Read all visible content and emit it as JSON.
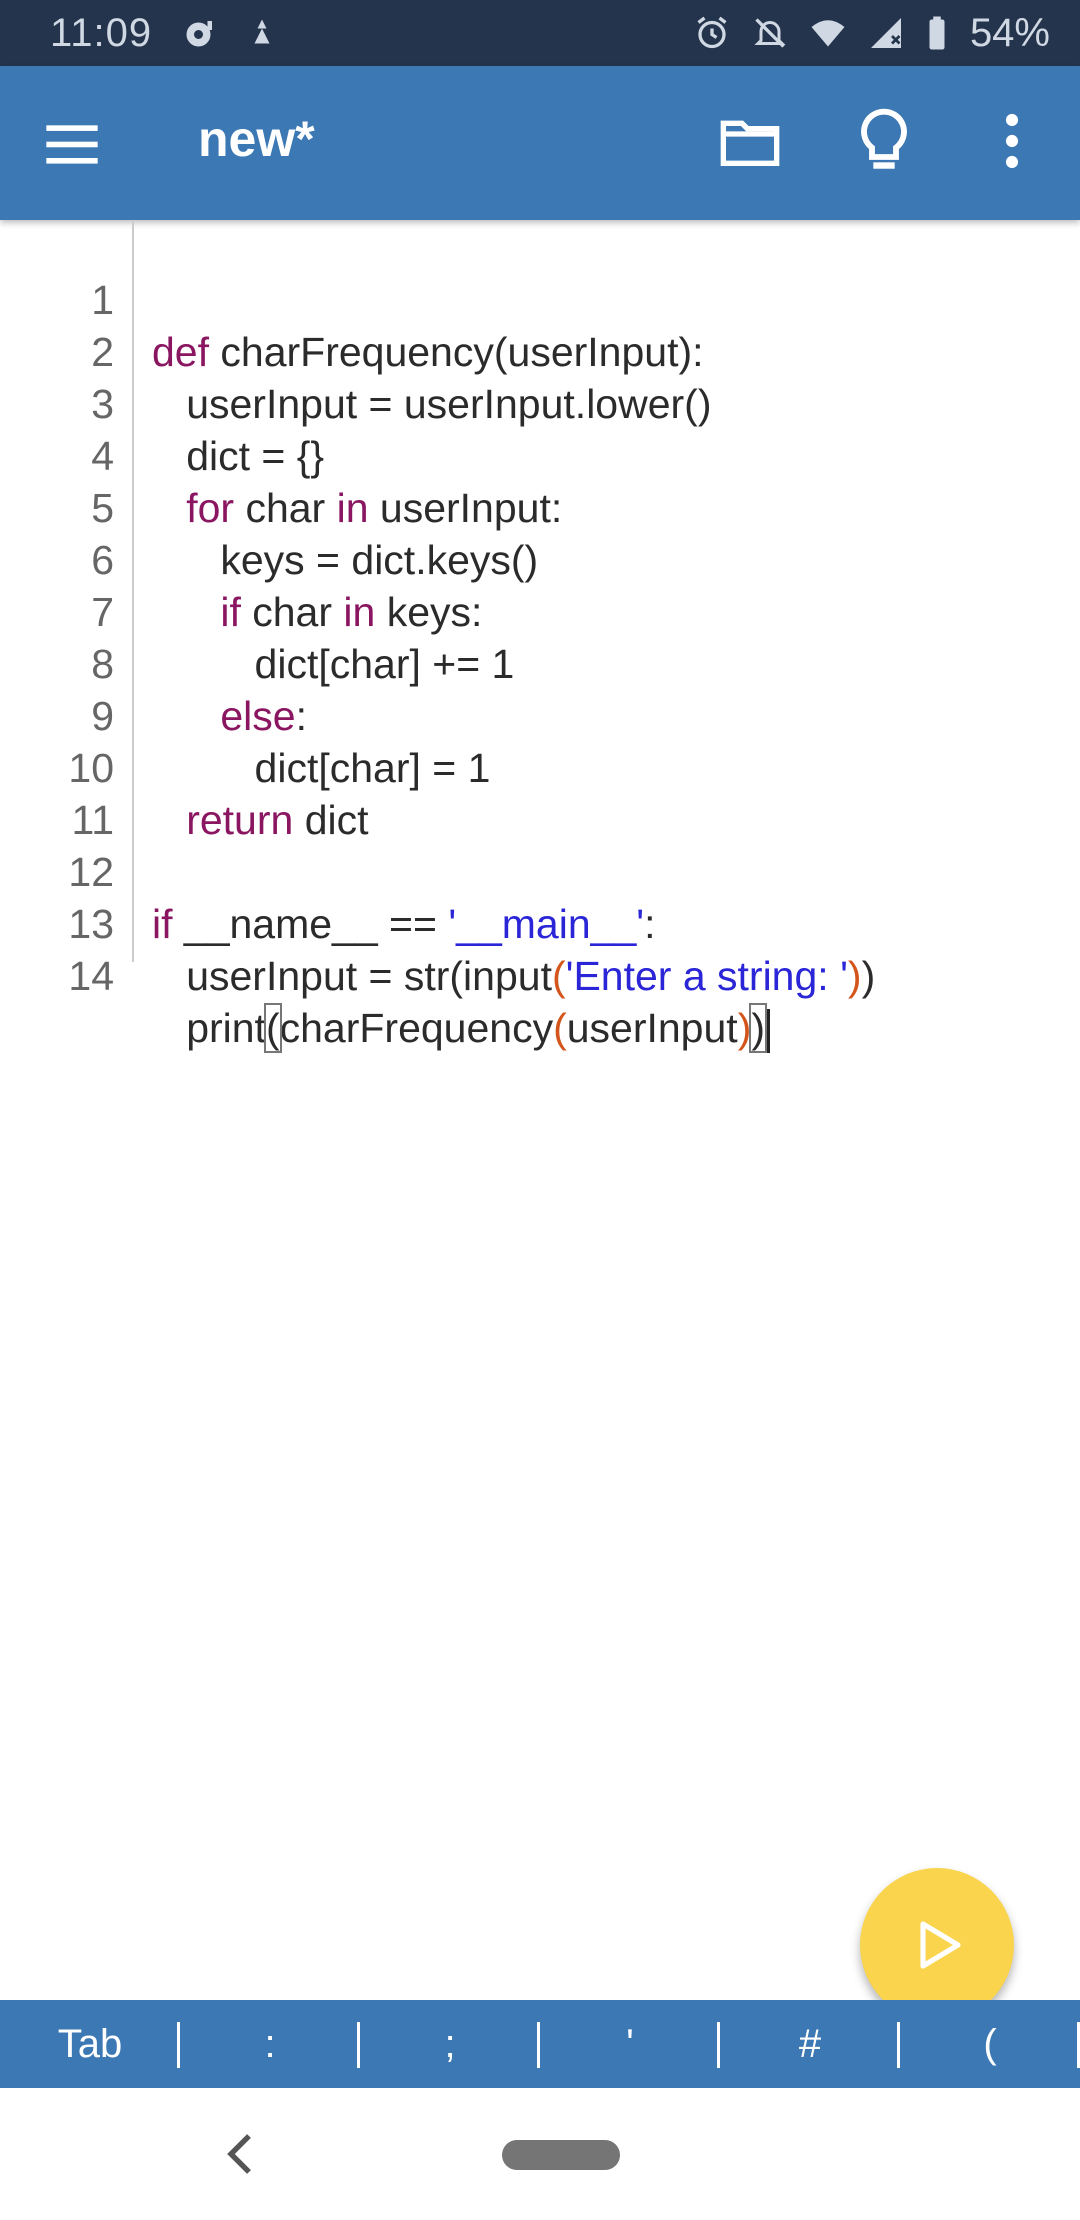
{
  "status_bar": {
    "time": "11:09",
    "battery": "54%"
  },
  "app_bar": {
    "title": "new*"
  },
  "editor": {
    "line_numbers": [
      "1",
      "2",
      "3",
      "4",
      "5",
      "6",
      "7",
      "8",
      "9",
      "10",
      "11",
      "12",
      "13",
      "14"
    ],
    "lines": {
      "l1": {
        "kw": "def",
        "rest": " charFrequency(userInput):"
      },
      "l2": {
        "indent": "   ",
        "text": "userInput = userInput.lower()"
      },
      "l3": {
        "indent": "   ",
        "text": "dict = {}"
      },
      "l4": {
        "indent": "   ",
        "kw1": "for",
        "mid": " char ",
        "kw2": "in",
        "rest": " userInput:"
      },
      "l5": {
        "indent": "      ",
        "text": "keys = dict.keys()"
      },
      "l6": {
        "indent": "      ",
        "kw1": "if",
        "mid": " char ",
        "kw2": "in",
        "rest": " keys:"
      },
      "l7": {
        "indent": "         ",
        "text": "dict[char] += 1"
      },
      "l8": {
        "indent": "      ",
        "kw": "else",
        "rest": ":"
      },
      "l9": {
        "indent": "         ",
        "text": "dict[char] = 1"
      },
      "l10": {
        "indent": "   ",
        "kw": "return",
        "rest": " dict"
      },
      "l12": {
        "kw": "if",
        "mid": " __name__ == ",
        "str": "'__main__'",
        "rest": ":"
      },
      "l13": {
        "indent": "   ",
        "pre": "userInput = str(input",
        "p1": "(",
        "str": "'Enter a string: '",
        "p2": ")",
        "post": ")"
      },
      "l14": {
        "indent": "   ",
        "pre": "print",
        "b1": "(",
        "mid": "charFrequency",
        "p1": "(",
        "arg": "userInput",
        "p2": ")",
        "b2": ")"
      }
    }
  },
  "symbol_bar": {
    "keys": [
      "Tab",
      ":",
      ";",
      "'",
      "#",
      "("
    ]
  },
  "icons": {
    "menu": "hamburger-menu-icon",
    "open": "folder-icon",
    "tips": "lightbulb-icon",
    "more": "more-vert-icon",
    "run": "play-icon",
    "back": "back-chevron-icon"
  },
  "colors": {
    "app_bar": "#3b78b4",
    "status_bar": "#24344c",
    "keyword": "#8a1561",
    "string": "#2a25d6",
    "paren": "#d4551c",
    "fab": "#f9d44c"
  }
}
